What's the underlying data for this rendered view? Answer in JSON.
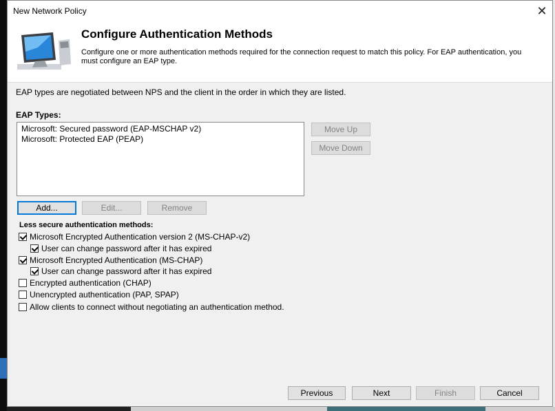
{
  "window": {
    "title": "New Network Policy",
    "close_glyph": "✕"
  },
  "header": {
    "title": "Configure Authentication Methods",
    "description": "Configure one or more authentication methods required for the connection request to match this policy. For EAP authentication, you must configure an EAP type.",
    "icon": "computer-monitor-icon"
  },
  "intro_text": "EAP types are negotiated between NPS and the client in the order in which they are listed.",
  "eap": {
    "label": "EAP Types:",
    "items": [
      "Microsoft: Secured password (EAP-MSCHAP v2)",
      "Microsoft: Protected EAP (PEAP)"
    ],
    "move_up": "Move Up",
    "move_down": "Move Down",
    "add": "Add...",
    "edit": "Edit...",
    "remove": "Remove"
  },
  "less_secure": {
    "label": "Less secure authentication methods:",
    "options": [
      {
        "label": "Microsoft Encrypted Authentication version 2 (MS-CHAP-v2)",
        "checked": true
      },
      {
        "label": "User can change password after it has expired",
        "checked": true
      },
      {
        "label": "Microsoft Encrypted Authentication (MS-CHAP)",
        "checked": true
      },
      {
        "label": "User can change password after it has expired",
        "checked": true
      },
      {
        "label": "Encrypted authentication (CHAP)",
        "checked": false
      },
      {
        "label": "Unencrypted authentication (PAP, SPAP)",
        "checked": false
      },
      {
        "label": "Allow clients to connect without negotiating an authentication method.",
        "checked": false
      }
    ]
  },
  "footer": {
    "previous": "Previous",
    "next": "Next",
    "finish": "Finish",
    "cancel": "Cancel"
  },
  "colors": {
    "accent": "#0078d7",
    "dialog_bg": "#f0f0f0"
  }
}
